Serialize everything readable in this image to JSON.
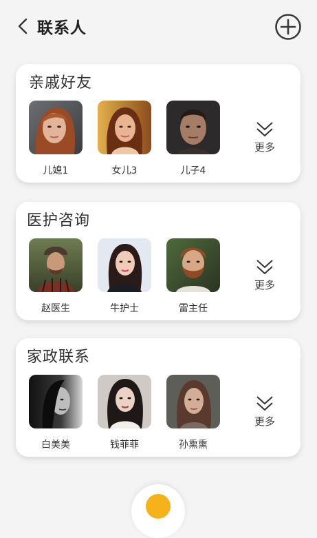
{
  "header": {
    "title": "联系人",
    "back_icon": "chevron-left-icon",
    "add_icon": "plus-circle-icon"
  },
  "groups": [
    {
      "title": "亲戚好友",
      "contacts": [
        {
          "name": "儿媳1"
        },
        {
          "name": "女儿3"
        },
        {
          "name": "儿子4"
        }
      ],
      "more_label": "更多"
    },
    {
      "title": "医护咨询",
      "contacts": [
        {
          "name": "赵医生"
        },
        {
          "name": "牛护士"
        },
        {
          "name": "雷主任"
        }
      ],
      "more_label": "更多"
    },
    {
      "title": "家政联系",
      "contacts": [
        {
          "name": "白美美"
        },
        {
          "name": "钱菲菲"
        },
        {
          "name": "孙熏熏"
        }
      ],
      "more_label": "更多"
    }
  ],
  "colors": {
    "background": "#f4f4f4",
    "card": "#ffffff",
    "accent": "#f5b21b"
  }
}
